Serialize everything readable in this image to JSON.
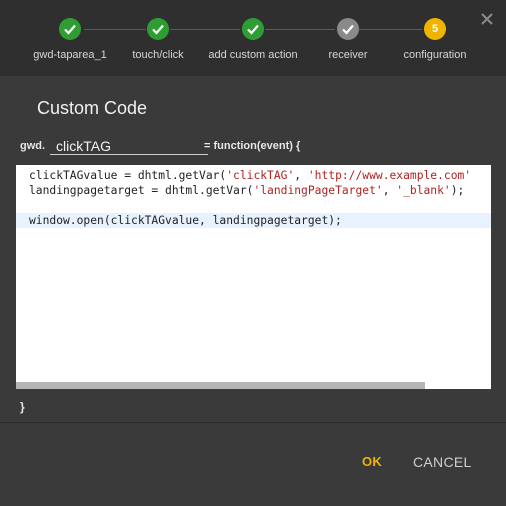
{
  "stepper": {
    "steps": [
      {
        "label": "gwd-taparea_1",
        "state": "done"
      },
      {
        "label": "touch/click",
        "state": "done"
      },
      {
        "label": "add custom action",
        "state": "done"
      },
      {
        "label": "receiver",
        "state": "current-gray"
      },
      {
        "label": "configuration",
        "state": "active",
        "number": "5"
      }
    ],
    "close_icon": "close-icon"
  },
  "dialog": {
    "title": "Custom Code",
    "signature": {
      "prefix": "gwd.",
      "function_name": "clickTAG",
      "suffix": "= function(event) {"
    },
    "code_lines": [
      {
        "a": "clickTAGvalue = dhtml.getVar(",
        "s1": "'clickTAG'",
        "b": ", ",
        "s2": "'http://www.example.com'",
        "c": ""
      },
      {
        "a": "landingpagetarget = dhtml.getVar(",
        "s1": "'landingPageTarget'",
        "b": ", ",
        "s2": "'_blank'",
        "c": ");"
      },
      {
        "a": "",
        "s1": "",
        "b": "",
        "s2": "",
        "c": ""
      },
      {
        "a": "window.open(clickTAGvalue, landingpagetarget);",
        "s1": "",
        "b": "",
        "s2": "",
        "c": ""
      }
    ],
    "closing_brace": "}"
  },
  "buttons": {
    "ok_label": "OK",
    "cancel_label": "CANCEL"
  },
  "colors": {
    "accent": "#f0b400",
    "done": "#2e9e33",
    "background": "#3a3a3a"
  }
}
